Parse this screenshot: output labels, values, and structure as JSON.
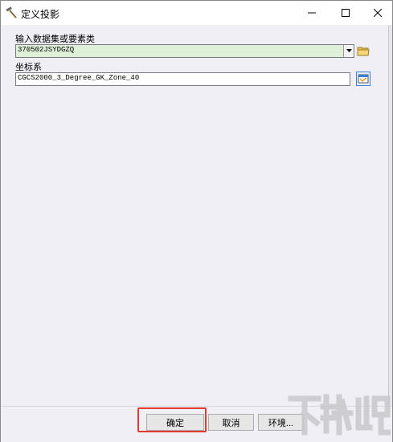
{
  "window": {
    "title": "定义投影",
    "app_icon": "hammer-icon"
  },
  "form": {
    "input_label": "输入数据集或要素类",
    "input_value": "370502JSYDGZQ",
    "coord_label": "坐标系",
    "coord_value": "CGCS2000_3_Degree_GK_Zone_40"
  },
  "buttons": {
    "ok": "确定",
    "cancel": "取消",
    "env": "环境..."
  },
  "colors": {
    "highlight": "#e33b2e",
    "input_bg": "#dff0d8",
    "dialog_bg": "#f0eff5"
  }
}
